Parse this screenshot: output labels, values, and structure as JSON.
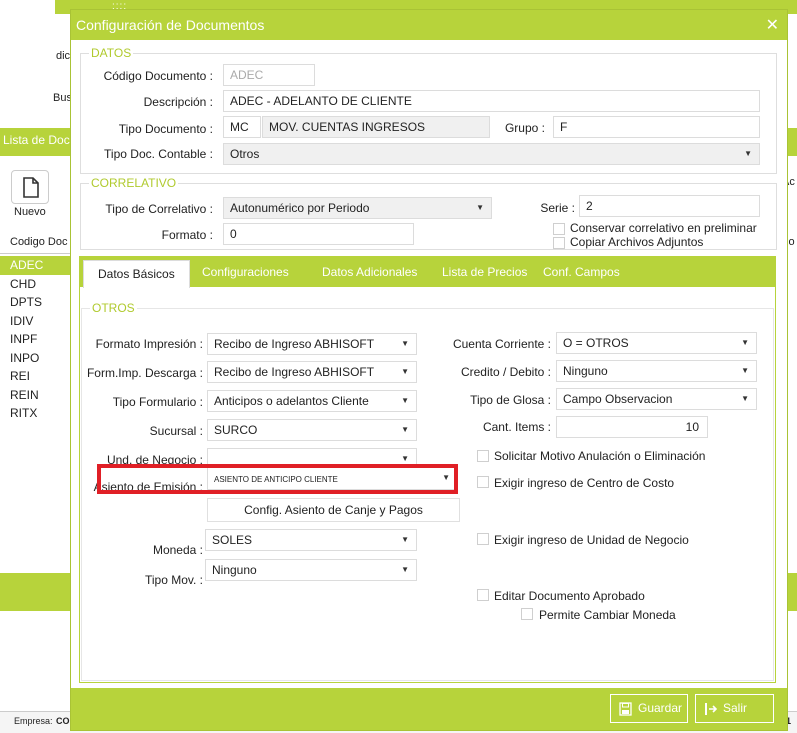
{
  "background": {
    "dots": "::::",
    "frag_dic": "dic",
    "frag_bus": "Bus",
    "lista_title": "Lista de Doc",
    "nuevo_label": "Nuevo",
    "col_header": "Codigo Doc",
    "right_frag_ac": "Ac",
    "right_frag_io": "io",
    "items": [
      "ADEC",
      "CHD",
      "DPTS",
      "IDIV",
      "INPF",
      "INPO",
      "REI",
      "REIN",
      "RITX"
    ],
    "status_label": "Empresa:",
    "status_value": "CO",
    "status_right": "1"
  },
  "dialog": {
    "title": "Configuración de Documentos",
    "close_icon": "close-icon"
  },
  "datos": {
    "legend": "DATOS",
    "codigo_label": "Código Documento :",
    "codigo_value": "ADEC",
    "descripcion_label": "Descripción :",
    "descripcion_value": "ADEC - ADELANTO DE CLIENTE",
    "tipo_doc_label": "Tipo Documento :",
    "tipo_doc_code": "MC",
    "tipo_doc_desc": "MOV. CUENTAS INGRESOS",
    "grupo_label": "Grupo :",
    "grupo_value": "F",
    "tipo_contable_label": "Tipo Doc. Contable :",
    "tipo_contable_value": "Otros"
  },
  "correlativo": {
    "legend": "CORRELATIVO",
    "tipo_label": "Tipo de Correlativo :",
    "tipo_value": "Autonumérico por Periodo",
    "serie_label": "Serie :",
    "serie_value": "2",
    "formato_label": "Formato :",
    "formato_value": "0",
    "conservar_label": "Conservar correlativo en preliminar",
    "copiar_label": "Copiar Archivos Adjuntos"
  },
  "tabs": [
    "Datos Básicos",
    "Configuraciones",
    "Datos Adicionales",
    "Lista de Precios",
    "Conf. Campos"
  ],
  "otros": {
    "legend": "OTROS",
    "formato_impresion_label": "Formato Impresión :",
    "formato_impresion_value": "Recibo de Ingreso ABHISOFT",
    "form_descarga_label": "Form.Imp. Descarga :",
    "form_descarga_value": "Recibo de Ingreso ABHISOFT",
    "tipo_formulario_label": "Tipo Formulario :",
    "tipo_formulario_value": "Anticipos o adelantos Cliente",
    "sucursal_label": "Sucursal :",
    "sucursal_value": "SURCO",
    "und_negocio_label": "Und. de Negocio :",
    "und_negocio_value": "",
    "asiento_label": "Asiento de Emisión :",
    "asiento_value": "ASIENTO DE ANTICIPO CLIENTE",
    "config_asiento_label": "Config. Asiento de Canje y Pagos",
    "moneda_label": "Moneda :",
    "moneda_value": "SOLES",
    "tipo_mov_label": "Tipo Mov. :",
    "tipo_mov_value": "Ninguno",
    "cuenta_corriente_label": "Cuenta Corriente :",
    "cuenta_corriente_value": "O = OTROS",
    "credito_debito_label": "Credito / Debito :",
    "credito_debito_value": "Ninguno",
    "tipo_glosa_label": "Tipo de Glosa :",
    "tipo_glosa_value": "Campo Observacion",
    "cant_items_label": "Cant. Items :",
    "cant_items_value": "10",
    "solicitar_motivo_label": "Solicitar Motivo Anulación o Eliminación",
    "exigir_centro_label": "Exigir ingreso de Centro de Costo",
    "exigir_unidad_label": "Exigir ingreso de Unidad de Negocio",
    "editar_aprobado_label": "Editar Documento Aprobado",
    "permite_moneda_label": "Permite Cambiar Moneda"
  },
  "footer": {
    "guardar_label": "Guardar",
    "salir_label": "Salir"
  },
  "colors": {
    "accent": "#b7d33b",
    "highlight": "#e01f26"
  }
}
